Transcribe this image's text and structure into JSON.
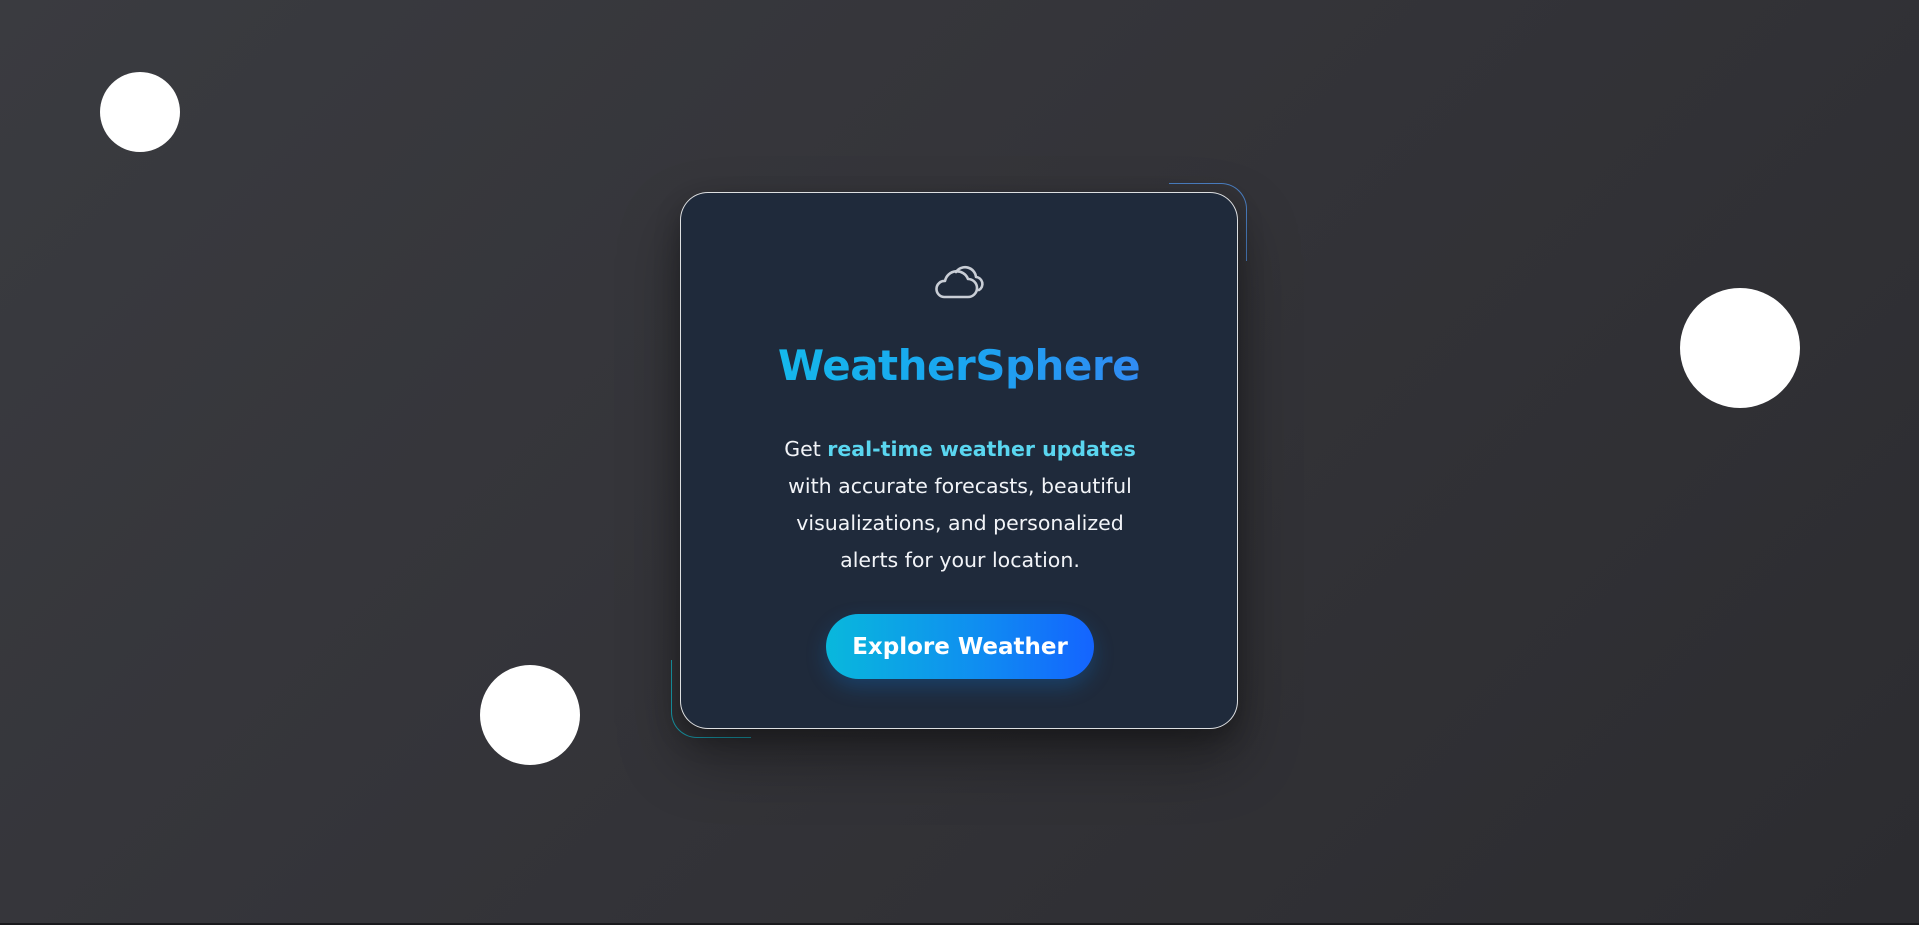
{
  "card": {
    "icon": "cloud-icon",
    "title": "WeatherSphere",
    "description": {
      "prefix": "Get",
      "highlight": "real-time weather updates",
      "suffix": "with accurate forecasts, beautiful visualizations, and personalized alerts for your location."
    },
    "cta_label": "Explore Weather"
  },
  "colors": {
    "background": "#36363b",
    "card": "#1f2a3b",
    "title_gradient_start": "#12c2e9",
    "title_gradient_end": "#3d7cf5",
    "highlight": "#5ad6f0",
    "button_gradient_start": "#09b8dc",
    "button_gradient_end": "#1464ff",
    "corner_top_right": "#4b7fc3",
    "corner_bottom_left": "#1aa7b8"
  }
}
